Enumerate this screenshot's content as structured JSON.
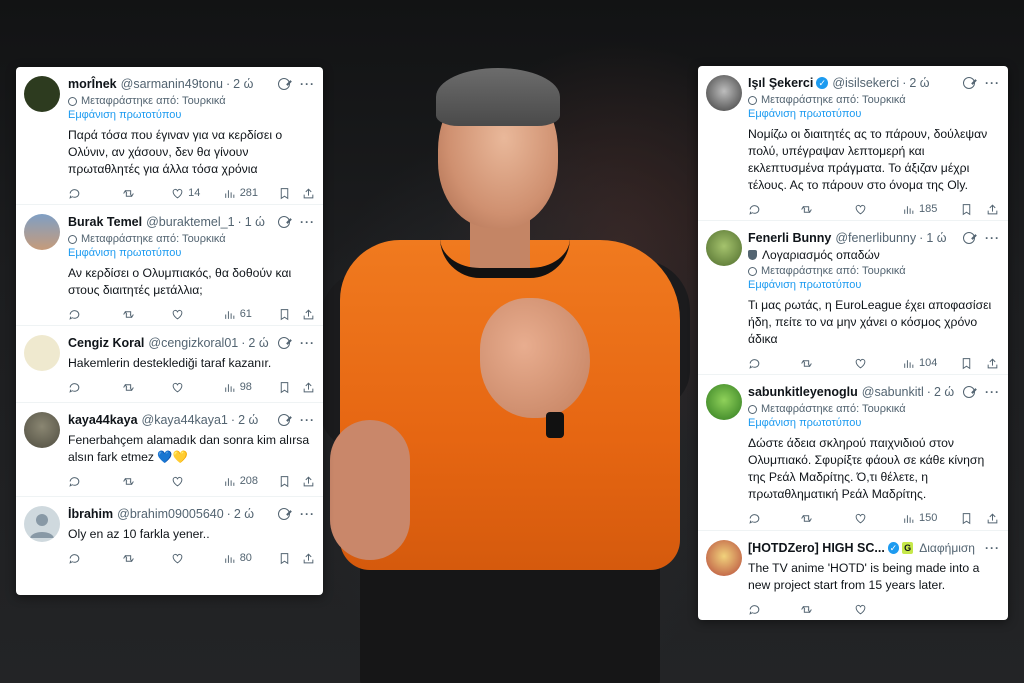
{
  "left_panel": {
    "tweets": [
      {
        "name": "morÎnek",
        "handle": "@sarmanin49tonu",
        "time": "2 ώ",
        "translated": "Μεταφράστηκε από: Τουρκικά",
        "show_original": "Εμφάνιση πρωτοτύπου",
        "text": "Παρά τόσα που έγιναν για να κερδίσει ο Ολύνιν, αν χάσουν, δεν θα γίνουν πρωταθλητές για άλλα τόσα χρόνια",
        "likes": "14",
        "views": "281",
        "avatar_color": "#2d3b1f"
      },
      {
        "name": "Burak Temel",
        "handle": "@buraktemel_1",
        "time": "1 ώ",
        "translated": "Μεταφράστηκε από: Τουρκικά",
        "show_original": "Εμφάνιση πρωτοτύπου",
        "text": "Αν κερδίσει ο Ολυμπιακός, θα δοθούν και στους διαιτητές μετάλλια;",
        "likes": "",
        "views": "61",
        "avatar_color": "#6c8fb3"
      },
      {
        "name": "Cengiz Koral",
        "handle": "@cengizkoral01",
        "time": "2 ώ",
        "text": "Hakemlerin desteklediği taraf kazanır.",
        "likes": "",
        "views": "98",
        "avatar_color": "#e9e4c8"
      },
      {
        "name": "kaya44kaya",
        "handle": "@kaya44kaya1",
        "time": "2 ώ",
        "text": "Fenerbahçem alamadık dan sonra kim alırsa alsın fark etmez 💙💛",
        "likes": "",
        "views": "208",
        "avatar_color": "#6b6a5a"
      },
      {
        "name": "İbrahim",
        "handle": "@brahim09005640",
        "time": "2 ώ",
        "text": "Oly en az 10 farkla yener..",
        "likes": "",
        "views": "80",
        "avatar_color": "#cfd9de"
      }
    ]
  },
  "right_panel": {
    "tweets": [
      {
        "name": "Işıl Şekerci",
        "handle": "@isilsekerci",
        "time": "2 ώ",
        "verified": true,
        "translated": "Μεταφράστηκε από: Τουρκικά",
        "show_original": "Εμφάνιση πρωτοτύπου",
        "text": "Νομίζω οι διαιτητές ας το πάρουν, δούλεψαν πολύ, υπέγραψαν λεπτομερή και εκλεπτυσμένα πράγματα. Το άξιζαν μέχρι τέλους. Ας το πάρουν στο όνομα της Oly.",
        "views": "185",
        "avatar_color": "#3a3a3a"
      },
      {
        "name": "Fenerli Bunny",
        "handle": "@fenerlibunny",
        "time": "1 ώ",
        "fan_label": "Λογαριασμός οπαδών",
        "translated": "Μεταφράστηκε από: Τουρκικά",
        "show_original": "Εμφάνιση πρωτοτύπου",
        "text": "Τι μας ρωτάς, η EuroLeague έχει αποφασίσει ήδη, πείτε το να μην χάνει ο κόσμος χρόνο άδικα",
        "views": "104",
        "avatar_color": "#4e6b2c"
      },
      {
        "name": "sabunkitleyenoglu",
        "handle": "@sabunkitl",
        "time": "2 ώ",
        "translated": "Μεταφράστηκε από: Τουρκικά",
        "show_original": "Εμφάνιση πρωτοτύπου",
        "text": "Δώστε άδεια σκληρού παιχνιδιού στον Ολυμπιακό. Σφυρίξτε φάουλ σε κάθε κίνηση της Ρεάλ Μαδρίτης. Ό,τι θέλετε, η πρωταθληματική Ρεάλ Μαδρίτης.",
        "views": "150",
        "avatar_color": "#4f9a2f"
      },
      {
        "name": "[HOTDZero]  HIGH SC...",
        "ad_label": "Διαφήμιση",
        "text": "The TV anime 'HOTD' is being made into a new project start from 15 years later.",
        "avatar_color": "#d9c46a"
      }
    ]
  },
  "colors": {
    "link": "#1d9bf0",
    "muted": "#536471",
    "text": "#0f1419",
    "referee_shirt": "#ee7318"
  },
  "icons": {
    "reply": "reply-icon",
    "retweet": "retweet-icon",
    "like": "like-icon",
    "views": "views-icon",
    "bookmark": "bookmark-icon",
    "share": "share-icon",
    "grok": "grok-icon",
    "more": "more-icon"
  }
}
